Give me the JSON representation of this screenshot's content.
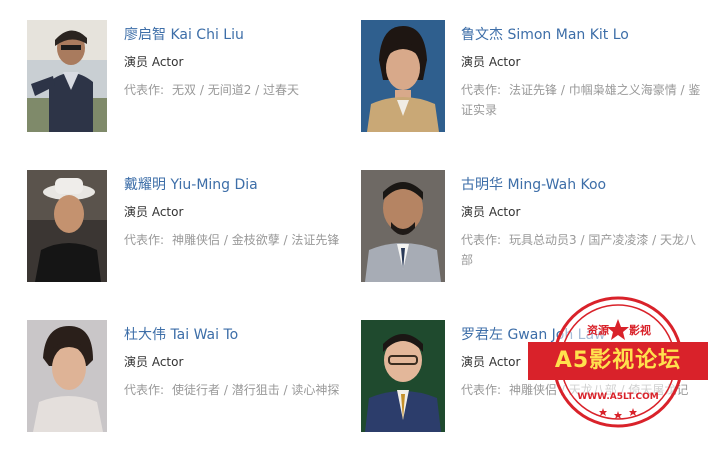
{
  "cast": [
    {
      "name": "廖启智 Kai Chi Liu",
      "role": "演员 Actor",
      "works_label": "代表作:",
      "works": "无双 / 无间道2 / 过春天"
    },
    {
      "name": "鲁文杰 Simon Man Kit Lo",
      "role": "演员 Actor",
      "works_label": "代表作:",
      "works": "法证先锋 / 巾帼枭雄之义海豪情 / 鉴证实录"
    },
    {
      "name": "戴耀明 Yiu-Ming Dia",
      "role": "演员 Actor",
      "works_label": "代表作:",
      "works": "神雕侠侣 / 金枝欲孽 / 法证先锋"
    },
    {
      "name": "古明华 Ming-Wah Koo",
      "role": "演员 Actor",
      "works_label": "代表作:",
      "works": "玩具总动员3 / 国产凌凌漆 / 天龙八部"
    },
    {
      "name": "杜大伟 Tai Wai To",
      "role": "演员 Actor",
      "works_label": "代表作:",
      "works": "使徒行者 / 潜行狙击 / 读心神探"
    },
    {
      "name": "罗君左 Gwan Joh Law",
      "role": "演员 Actor",
      "works_label": "代表作:",
      "works": "神雕侠侣 / 天龙八部 / 倚天屠龙记"
    }
  ],
  "watermark": {
    "top_left": "资源",
    "top_right": "影视",
    "main": "A5影视论坛",
    "url": "WWW.A5LT.COM",
    "color": "#d9222a"
  }
}
